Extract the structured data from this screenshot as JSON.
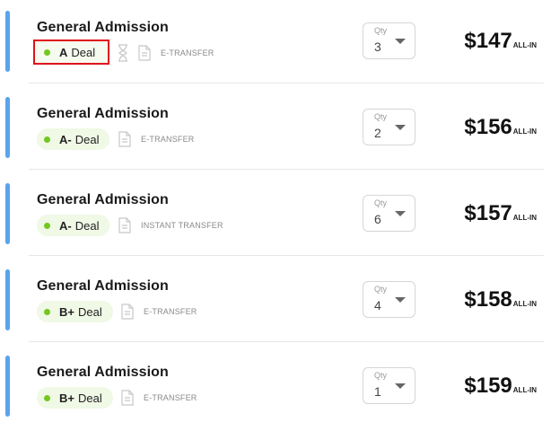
{
  "listings": [
    {
      "title": "General Admission",
      "grade": "A",
      "deal_word": "Deal",
      "has_hourglass": true,
      "transfer": "E-TRANSFER",
      "qty_label": "Qty",
      "qty": "3",
      "price": "$147",
      "suffix": "ALL-IN",
      "highlighted": true
    },
    {
      "title": "General Admission",
      "grade": "A-",
      "deal_word": "Deal",
      "has_hourglass": false,
      "transfer": "E-TRANSFER",
      "qty_label": "Qty",
      "qty": "2",
      "price": "$156",
      "suffix": "ALL-IN",
      "highlighted": false
    },
    {
      "title": "General Admission",
      "grade": "A-",
      "deal_word": "Deal",
      "has_hourglass": false,
      "transfer": "INSTANT TRANSFER",
      "qty_label": "Qty",
      "qty": "6",
      "price": "$157",
      "suffix": "ALL-IN",
      "highlighted": false
    },
    {
      "title": "General Admission",
      "grade": "B+",
      "deal_word": "Deal",
      "has_hourglass": false,
      "transfer": "E-TRANSFER",
      "qty_label": "Qty",
      "qty": "4",
      "price": "$158",
      "suffix": "ALL-IN",
      "highlighted": false
    },
    {
      "title": "General Admission",
      "grade": "B+",
      "deal_word": "Deal",
      "has_hourglass": false,
      "transfer": "E-TRANSFER",
      "qty_label": "Qty",
      "qty": "1",
      "price": "$159",
      "suffix": "ALL-IN",
      "highlighted": false
    }
  ],
  "colors": {
    "accent": "#5aa3ee",
    "deal_dot": "#72c81f",
    "highlight_border": "#e0121c"
  },
  "icons": {
    "hourglass": "hourglass-icon",
    "document": "document-icon",
    "dropdown": "chevron-down-icon"
  }
}
